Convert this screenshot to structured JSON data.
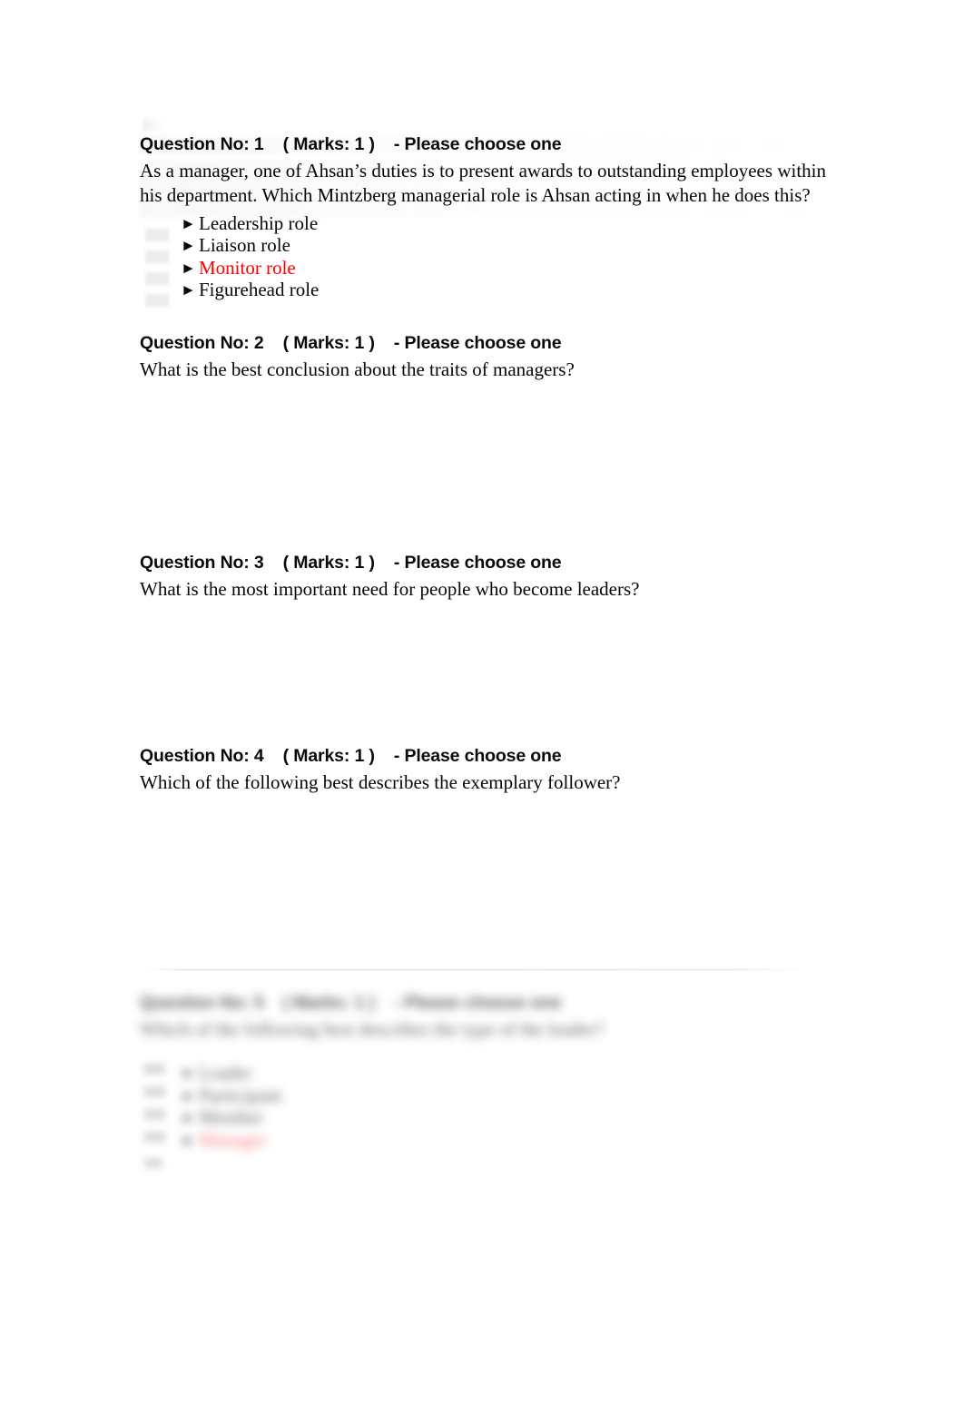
{
  "document": {
    "type": "exam-question-paper",
    "accent_selected_color": "#ff0000",
    "page_background": "#ffffff",
    "text_color": "#060606"
  },
  "questions": [
    {
      "heading": "Question No: 1    ( Marks: 1 )    - Please choose one",
      "text": "As a manager, one of Ahsan’s duties is to present awards to outstanding employees within his department. Which Mintzberg managerial role is Ahsan acting in when he does this?",
      "marker": "►",
      "options": [
        {
          "label": "Leadership role",
          "selected": false
        },
        {
          "label": "Liaison role",
          "selected": false
        },
        {
          "label": "Monitor role",
          "selected": true
        },
        {
          "label": "Figurehead role",
          "selected": false
        }
      ]
    },
    {
      "heading": "Question No: 2    ( Marks: 1 )    - Please choose one",
      "text": "What is the best conclusion about the traits of managers?",
      "marker": "►",
      "options": []
    },
    {
      "heading": "Question No: 3    ( Marks: 1 )    - Please choose one",
      "text": "What is the most important need for people who become leaders?",
      "marker": "►",
      "options": []
    },
    {
      "heading": "Question No: 4    ( Marks: 1 )    - Please choose one",
      "text": "Which of the following best describes the exemplary follower?",
      "marker": "►",
      "options": []
    }
  ],
  "obscured_question": {
    "note": "illegible - heavily blurred in source image",
    "heading": "Question No: 5    ( Marks: 1 )    - Please choose one",
    "text": "Which of the following best describes the type of the leader?",
    "marker": "►",
    "options": [
      {
        "label": "Leader",
        "selected": false
      },
      {
        "label": "Participant",
        "selected": false
      },
      {
        "label": "Member",
        "selected": false
      },
      {
        "label": "Manager",
        "selected": true
      }
    ]
  }
}
